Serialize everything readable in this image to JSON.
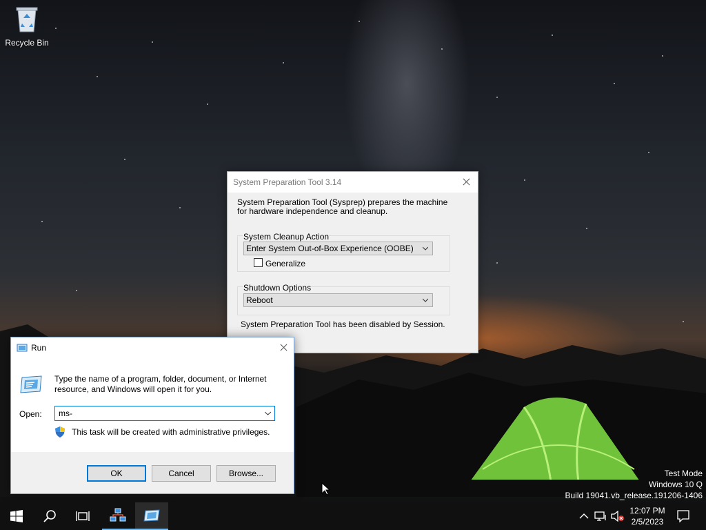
{
  "desktop": {
    "icons": [
      {
        "label": "Recycle Bin",
        "icon": "recycle-bin-icon"
      }
    ],
    "watermark": {
      "line1": "Test Mode",
      "line2": "Windows 10 Q",
      "line3": "Build 19041.vb_release.191206-1406"
    }
  },
  "sysprep": {
    "title": "System Preparation Tool 3.14",
    "description": "System Preparation Tool (Sysprep) prepares the machine for hardware independence and cleanup.",
    "cleanup_group_label": "System Cleanup Action",
    "cleanup_selected": "Enter System Out-of-Box Experience (OOBE)",
    "generalize_label": "Generalize",
    "generalize_checked": false,
    "shutdown_group_label": "Shutdown Options",
    "shutdown_selected": "Reboot",
    "status": "System Preparation Tool has been disabled by Session."
  },
  "run": {
    "title": "Run",
    "description": "Type the name of a program, folder, document, or Internet resource, and Windows will open it for you.",
    "open_label": "Open:",
    "open_value": "ms-",
    "admin_note": "This task will be created with administrative privileges.",
    "ok_label": "OK",
    "cancel_label": "Cancel",
    "browse_label": "Browse..."
  },
  "taskbar": {
    "clock_time": "12:07 PM",
    "clock_date": "2/5/2023"
  },
  "colors": {
    "accent": "#0078d7",
    "taskbar": "#101010",
    "tent_green": "#8be04a"
  }
}
